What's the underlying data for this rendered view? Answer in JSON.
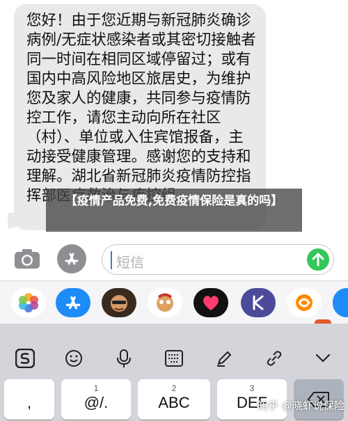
{
  "message": {
    "text": "您好！由于您近期与新冠肺炎确诊病例/无症状感染者或其密切接触者同一时间在相同区域停留过；或有国内中高风险地区旅居史，为维护您及家人的健康，共同参与疫情防控工作，请您主动向所在社区（村）、单位或入住宾馆报备，主动接受健康管理。感谢您的支持和理解。湖北省新冠肺炎疫情防控指挥部医疗救治与疾控组。"
  },
  "overlay": {
    "title": "【疫情产品免费,免费疫情保险是真的吗】"
  },
  "input": {
    "placeholder": "短信"
  },
  "apps": [
    {
      "name": "photos-app",
      "color": "#ffffff"
    },
    {
      "name": "appstore-app",
      "color": "#1e8cf8"
    },
    {
      "name": "memoji-app",
      "color": "#3a2a1e"
    },
    {
      "name": "animoji-app",
      "color": "#ffffff"
    },
    {
      "name": "heart-app",
      "color": "#111111"
    },
    {
      "name": "k-app",
      "color": "#4b4b9a"
    },
    {
      "name": "orange-app",
      "color": "#ff8a00"
    },
    {
      "name": "blue-app",
      "color": "#1e8cf8"
    }
  ],
  "keys": [
    {
      "num": "",
      "label": ","
    },
    {
      "num": "1",
      "label": "@/."
    },
    {
      "num": "2",
      "label": "ABC"
    },
    {
      "num": "3",
      "label": "DEF"
    }
  ],
  "watermark": "知乎 @晓虾说保险",
  "colors": {
    "send": "#34c759",
    "bubble": "#e9e9eb",
    "keyboard": "#d3d5da"
  }
}
